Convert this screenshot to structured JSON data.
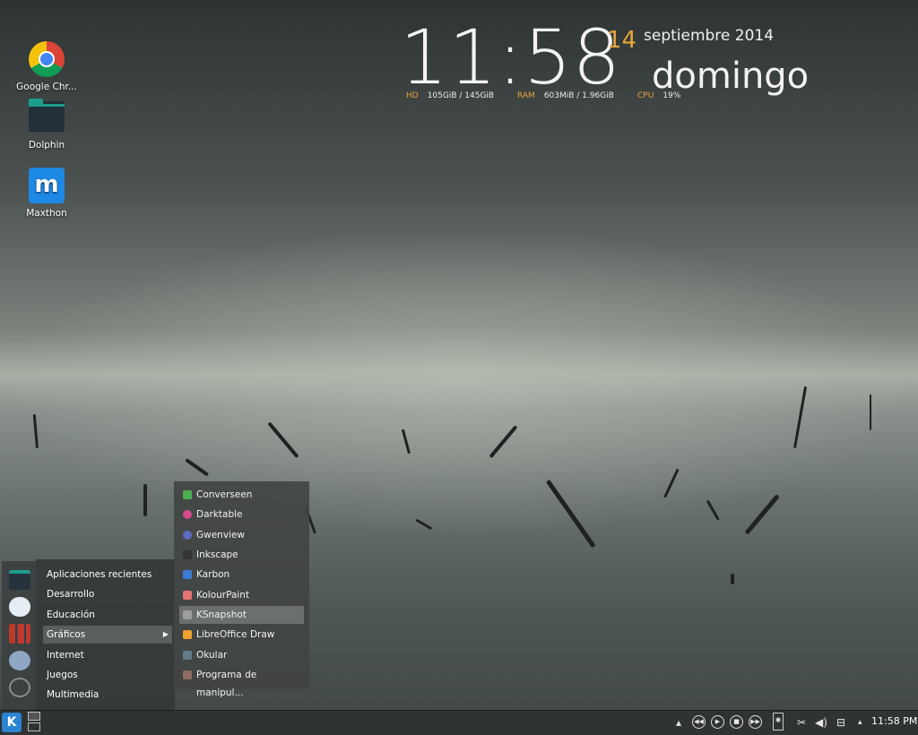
{
  "desktop_icons": [
    {
      "label": "Google Chr...",
      "icon": "chrome-icon"
    },
    {
      "label": "Dolphin",
      "icon": "folder-icon"
    },
    {
      "label": "Maxthon",
      "icon": "maxthon-icon"
    }
  ],
  "clock": {
    "time": "11:58",
    "day": "14",
    "month_year": "septiembre 2014",
    "weekday": "domingo",
    "hd_label": "HD",
    "hd_value": "105GiB  / 145GiB",
    "ram_label": "RAM",
    "ram_value": "603MiB  / 1.96GiB",
    "cpu_label": "CPU",
    "cpu_value": "19%"
  },
  "menu": {
    "categories": [
      "Aplicaciones recientes",
      "Desarrollo",
      "Educación",
      "Gráficos",
      "Internet",
      "Juegos",
      "Multimedia"
    ],
    "active_index": 3,
    "submenu": [
      {
        "label": "Converseen",
        "color": "#4caf50"
      },
      {
        "label": "Darktable",
        "color": "#d84a8a"
      },
      {
        "label": "Gwenview",
        "color": "#5c6bc0"
      },
      {
        "label": "Inkscape",
        "color": "#333333"
      },
      {
        "label": "Karbon",
        "color": "#3a7bd5"
      },
      {
        "label": "KolourPaint",
        "color": "#e57373"
      },
      {
        "label": "KSnapshot",
        "color": "#9e9e9e"
      },
      {
        "label": "LibreOffice Draw",
        "color": "#f0a030"
      },
      {
        "label": "Okular",
        "color": "#607d8b"
      },
      {
        "label": "Programa de manipul...",
        "color": "#8d6e63"
      }
    ],
    "active_sub_index": 6
  },
  "taskbar": {
    "launcher": "K",
    "time": "11:58 PM"
  },
  "colors": {
    "accent": "#e8a33b",
    "kde_blue": "#2a84d2"
  }
}
